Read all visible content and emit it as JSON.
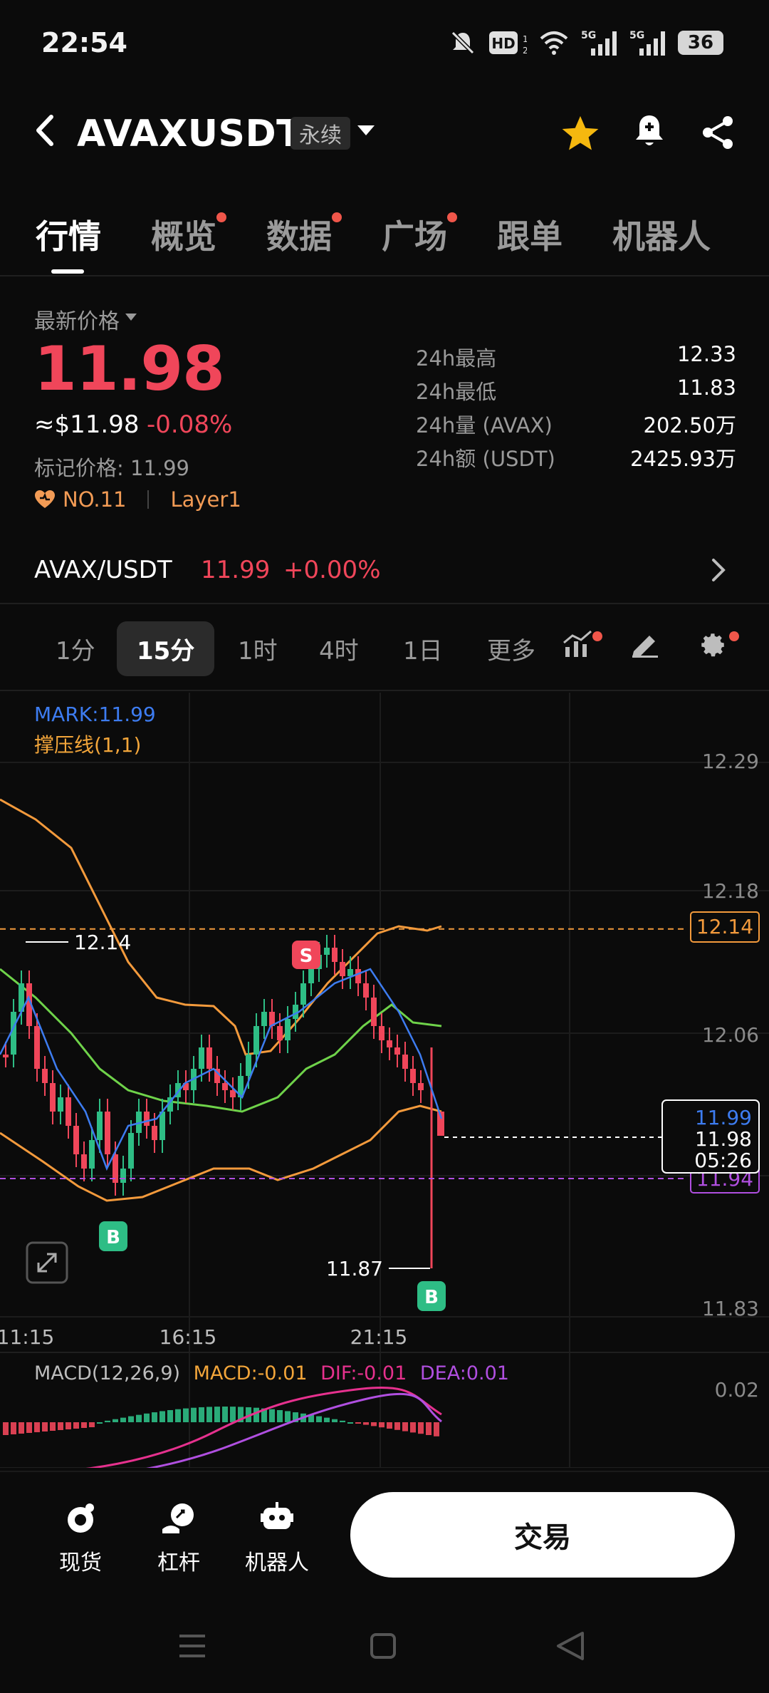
{
  "status_bar": {
    "time": "22:54",
    "battery": "36"
  },
  "header": {
    "pair": "AVAXUSDT",
    "tag": "永续"
  },
  "tabs": [
    {
      "label": "行情",
      "dot": false
    },
    {
      "label": "概览",
      "dot": true
    },
    {
      "label": "数据",
      "dot": true
    },
    {
      "label": "广场",
      "dot": true
    },
    {
      "label": "跟单",
      "dot": false
    },
    {
      "label": "机器人",
      "dot": false
    }
  ],
  "price": {
    "label": "最新价格",
    "last": "11.98",
    "usd": "≈$11.98",
    "change": "-0.08%",
    "mark": "标记价格: 11.99",
    "rank": "NO.11",
    "sector": "Layer1"
  },
  "stats": [
    {
      "k": "24h最高",
      "v": "12.33"
    },
    {
      "k": "24h最低",
      "v": "11.83"
    },
    {
      "k": "24h量 (AVAX)",
      "v": "202.50万"
    },
    {
      "k": "24h额 (USDT)",
      "v": "2425.93万"
    }
  ],
  "spot": {
    "pair": "AVAX/USDT",
    "price": "11.99",
    "change": "+0.00%"
  },
  "timeframes": [
    "1分",
    "15分",
    "1时",
    "4时",
    "1日",
    "更多"
  ],
  "active_timeframe": "15分",
  "chart": {
    "mark_legend": "MARK:11.99",
    "indicator_legend": "撑压线(1,1)",
    "y_labels": [
      "12.29",
      "12.18",
      "12.06",
      "11.83"
    ],
    "x_labels": [
      "11:15",
      "16:15",
      "21:15"
    ],
    "high_marker": "12.14",
    "low_marker": "11.87",
    "resistance_tag": "12.14",
    "support_tag": "11.94",
    "price_box": {
      "mark": "11.99",
      "last": "11.98",
      "countdown": "05:26"
    },
    "signal_sell": "S",
    "signal_buy": "B",
    "macd_legend": {
      "name": "MACD(12,26,9)",
      "macd": "MACD:-0.01",
      "dif": "DIF:-0.01",
      "dea": "DEA:0.01"
    },
    "macd_y_label": "0.02",
    "colors": {
      "up": "#2ebd85",
      "down": "#f0465a",
      "boll_upper": "#f39a3c",
      "boll_mid": "#6fd34a",
      "mark_line": "#3d7cf0",
      "support": "#b04fe0"
    }
  },
  "chart_data": {
    "type": "candlestick",
    "x": [
      "11:15",
      "16:15",
      "21:15"
    ],
    "ylim": [
      11.83,
      12.29
    ],
    "marked_high": 12.14,
    "marked_low": 11.87,
    "last": 11.98,
    "mark": 11.99
  },
  "bottom_nav": {
    "spot": "现货",
    "margin": "杠杆",
    "bot": "机器人",
    "trade": "交易"
  }
}
